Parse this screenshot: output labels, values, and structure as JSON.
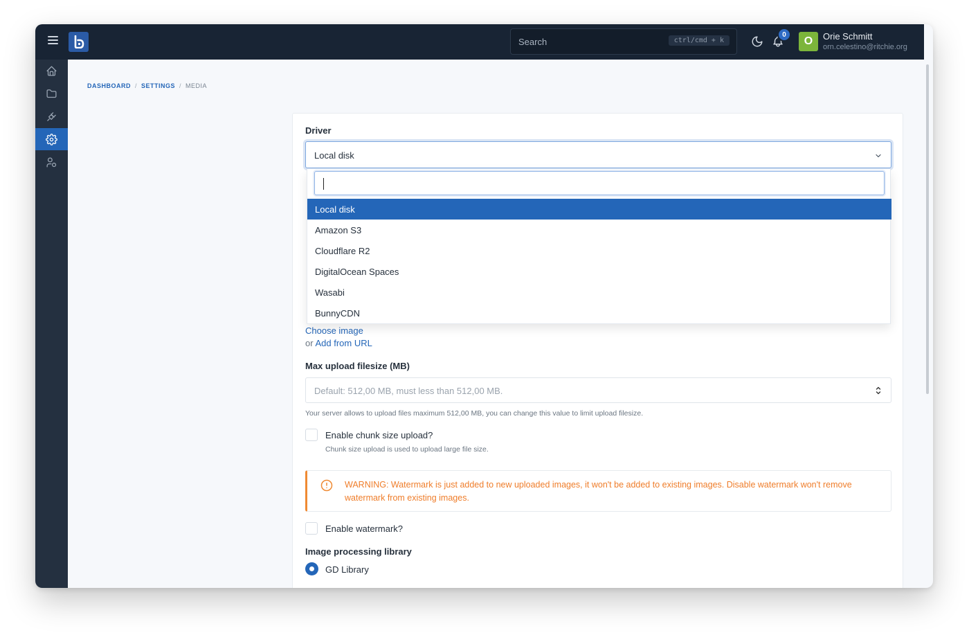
{
  "header": {
    "search_placeholder": "Search",
    "search_shortcut": "ctrl/cmd + k",
    "notification_count": "0",
    "user": {
      "initial": "O",
      "name": "Orie Schmitt",
      "email": "orn.celestino@ritchie.org"
    }
  },
  "sidebar": {
    "items": [
      {
        "icon": "home-icon"
      },
      {
        "icon": "folder-icon"
      },
      {
        "icon": "plug-icon"
      },
      {
        "icon": "gear-icon",
        "active": true
      },
      {
        "icon": "users-icon"
      }
    ]
  },
  "breadcrumb": {
    "dashboard": "DASHBOARD",
    "settings": "SETTINGS",
    "current": "MEDIA",
    "separator": "/"
  },
  "form": {
    "driver_label": "Driver",
    "driver_value": "Local disk",
    "driver_options": [
      "Local disk",
      "Amazon S3",
      "Cloudflare R2",
      "DigitalOcean Spaces",
      "Wasabi",
      "BunnyCDN"
    ],
    "choose_image": "Choose image",
    "or_text": "or",
    "add_from_url": "Add from URL",
    "max_upload_label": "Max upload filesize (MB)",
    "max_upload_placeholder": "Default: 512,00 MB, must less than 512,00 MB.",
    "max_upload_help": "Your server allows to upload files maximum 512,00 MB, you can change this value to limit upload filesize.",
    "chunk_label": "Enable chunk size upload?",
    "chunk_help": "Chunk size upload is used to upload large file size.",
    "warning_text": "WARNING: Watermark is just added to new uploaded images, it won't be added to existing images. Disable watermark won't remove watermark from existing images.",
    "watermark_label": "Enable watermark?",
    "image_lib_label": "Image processing library",
    "gd_library": "GD Library"
  },
  "colors": {
    "topbar": "#182434",
    "sidebar": "#243040",
    "accent": "#2466b8",
    "warning": "#ef8a33",
    "avatar": "#7cb53b"
  }
}
